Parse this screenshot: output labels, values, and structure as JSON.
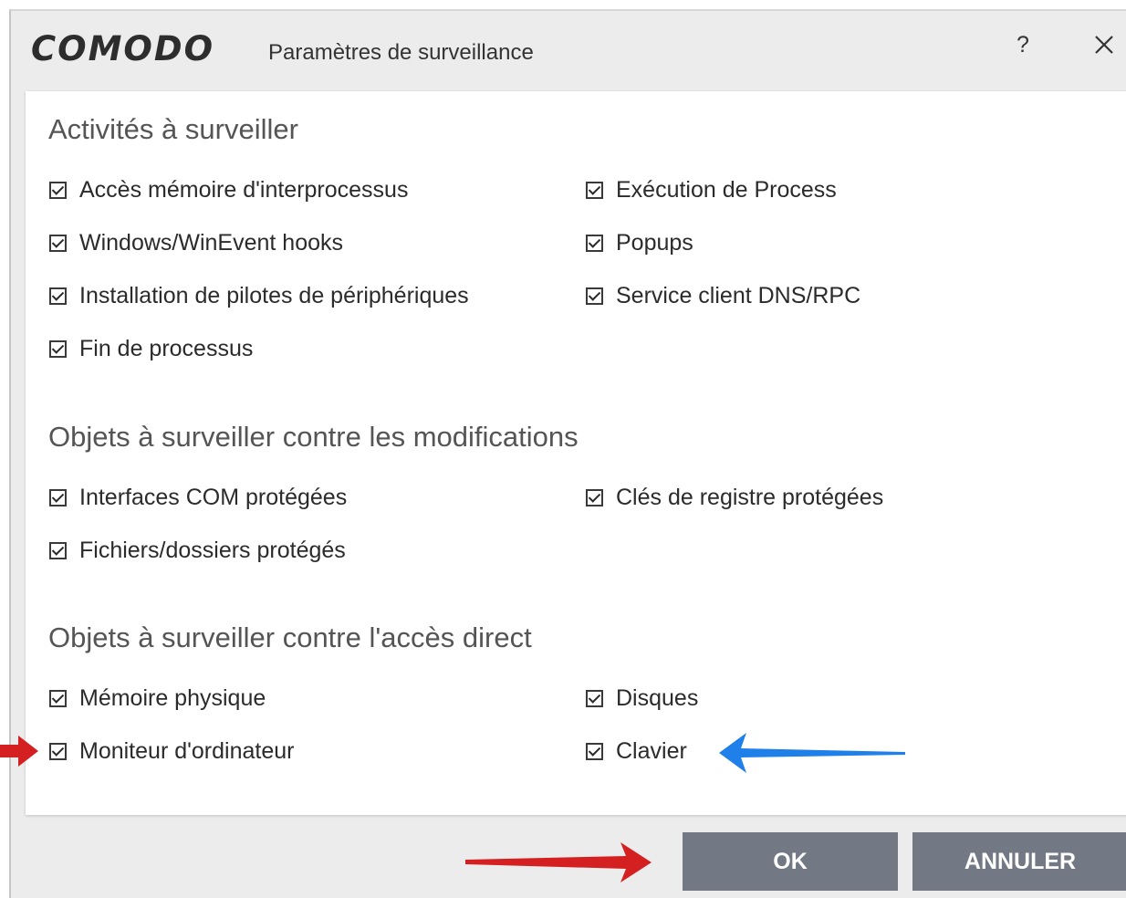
{
  "dialog": {
    "logo": "COMODO",
    "title": "Paramètres de surveillance",
    "help_label": "?",
    "close_icon": "close-icon"
  },
  "sections": [
    {
      "title": "Activités à surveiller",
      "options": [
        {
          "label": "Accès mémoire d'interprocessus",
          "checked": true
        },
        {
          "label": "Exécution de Process",
          "checked": true
        },
        {
          "label": "Windows/WinEvent hooks",
          "checked": true
        },
        {
          "label": "Popups",
          "checked": true
        },
        {
          "label": "Installation de pilotes de périphériques",
          "checked": true
        },
        {
          "label": "Service client DNS/RPC",
          "checked": true
        },
        {
          "label": "Fin de processus",
          "checked": true
        }
      ]
    },
    {
      "title": "Objets à surveiller contre les modifications",
      "options": [
        {
          "label": "Interfaces COM protégées",
          "checked": true
        },
        {
          "label": "Clés de registre protégées",
          "checked": true
        },
        {
          "label": "Fichiers/dossiers protégés",
          "checked": true
        }
      ]
    },
    {
      "title": "Objets à surveiller contre l'accès direct",
      "options": [
        {
          "label": "Mémoire physique",
          "checked": true
        },
        {
          "label": "Disques",
          "checked": true
        },
        {
          "label": "Moniteur d'ordinateur",
          "checked": true
        },
        {
          "label": "Clavier",
          "checked": true
        }
      ]
    }
  ],
  "buttons": {
    "ok": "OK",
    "cancel": "ANNULER"
  },
  "annotations": {
    "red_color": "#d42020",
    "blue_color": "#1f80ea"
  }
}
